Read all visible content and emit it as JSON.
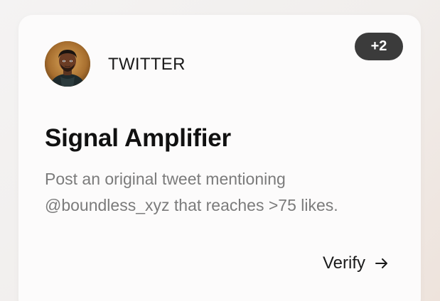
{
  "card": {
    "platform": "TWITTER",
    "badge": "+2",
    "title": "Signal Amplifier",
    "description": "Post an original tweet mentioning @boundless_xyz that reaches >75 likes.",
    "action_label": "Verify",
    "avatar_icon": "user-avatar",
    "action_icon": "arrow-right-icon"
  },
  "colors": {
    "badge_bg": "#3b3b3b",
    "title_text": "#111111",
    "description_text": "#7b7b7b",
    "card_bg": "#fcfbfb"
  }
}
